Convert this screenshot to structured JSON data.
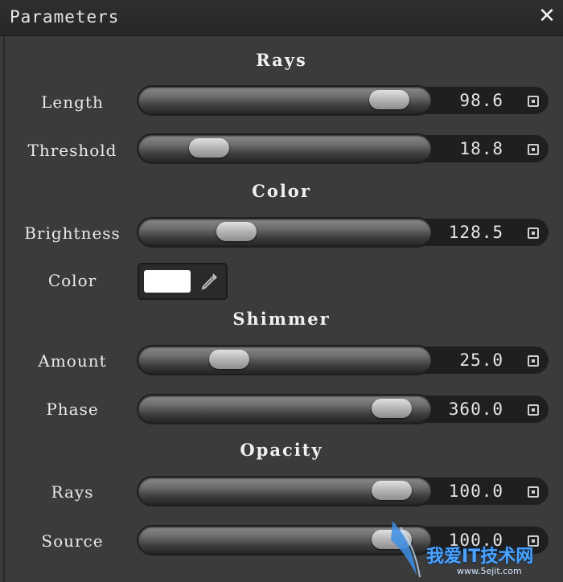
{
  "window": {
    "title": "Parameters"
  },
  "sections": {
    "rays": "Rays",
    "color": "Color",
    "shimmer": "Shimmer",
    "opacity": "Opacity"
  },
  "controls": {
    "length": {
      "label": "Length",
      "value": "98.6",
      "fraction": 0.93
    },
    "threshold": {
      "label": "Threshold",
      "value": "18.8",
      "fraction": 0.19
    },
    "brightness": {
      "label": "Brightness",
      "value": "128.5",
      "fraction": 0.3
    },
    "color": {
      "label": "Color",
      "swatch": "#ffffff"
    },
    "amount": {
      "label": "Amount",
      "value": "25.0",
      "fraction": 0.27
    },
    "phase": {
      "label": "Phase",
      "value": "360.0",
      "fraction": 0.94
    },
    "rays_opacity": {
      "label": "Rays",
      "value": "100.0",
      "fraction": 0.94
    },
    "source_opacity": {
      "label": "Source",
      "value": "100.0",
      "fraction": 0.94
    }
  },
  "icons": {
    "close": "close-icon",
    "keyframe": "keyframe-icon",
    "eyedropper": "eyedropper-icon"
  },
  "watermark": {
    "text": "我爱IT技术网",
    "url": "www.5ejit.com"
  }
}
